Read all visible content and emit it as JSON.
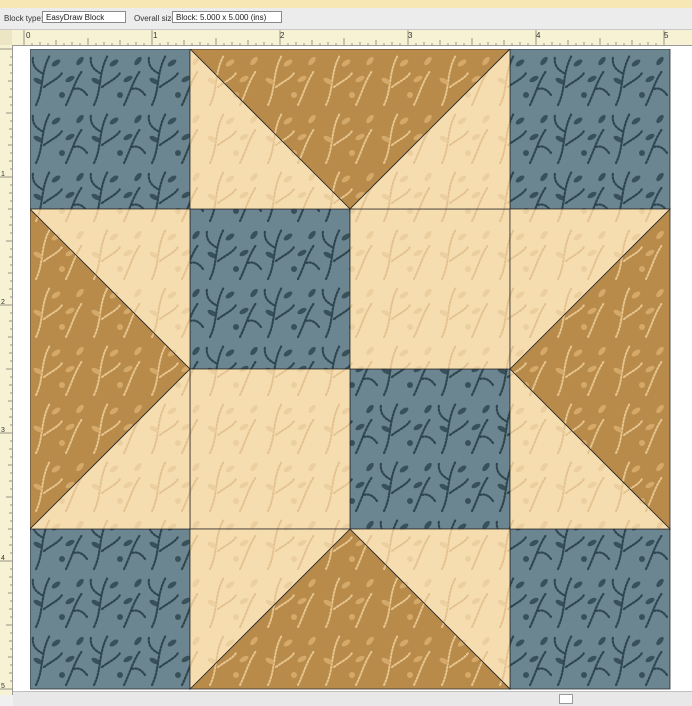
{
  "infobar": {
    "block_type_label": "Block type:",
    "block_type_value": "EasyDraw Block",
    "overall_size_label": "Overall size:",
    "overall_size_value": "Block: 5.000 x 5.000 (ins)"
  },
  "ruler": {
    "top_labels": [
      "0",
      "1",
      "2",
      "3",
      "4",
      "5"
    ],
    "left_labels": [
      "1",
      "2",
      "3",
      "4",
      "5"
    ]
  },
  "quilt": {
    "colors": {
      "blue": "#6b8690",
      "gold": "#b98b4a",
      "cream": "#f6ddb0",
      "seam": "#2a2a2a"
    }
  }
}
